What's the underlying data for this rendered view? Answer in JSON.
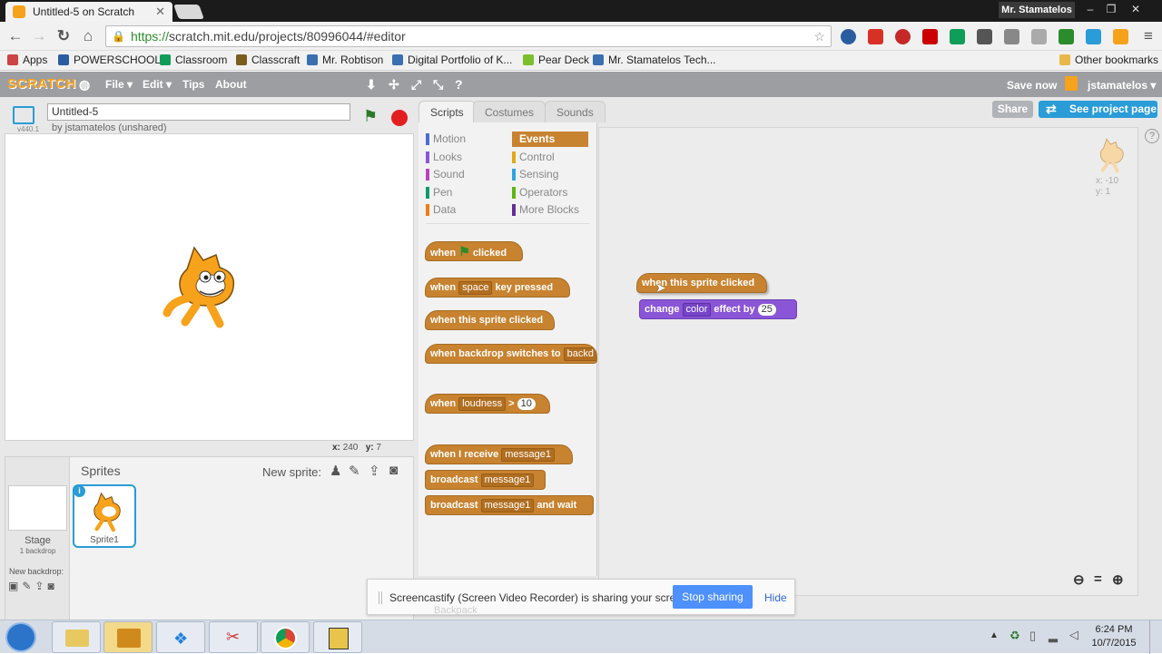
{
  "browser": {
    "tab_title": "Untitled-5 on Scratch",
    "user_chip": "Mr. Stamatelos",
    "url_https": "https://",
    "url_rest": "scratch.mit.edu/projects/80996044/#editor",
    "bookmarks": [
      {
        "label": "Apps",
        "color": "#555"
      },
      {
        "label": "POWERSCHOOL",
        "color": "#2a5d9f"
      },
      {
        "label": "Classroom",
        "color": "#0f9d58"
      },
      {
        "label": "Classcraft",
        "color": "#7a5c1e"
      },
      {
        "label": "Mr. Robtison",
        "color": "#3a6fb0"
      },
      {
        "label": "Digital Portfolio of K...",
        "color": "#3a6fb0"
      },
      {
        "label": "Pear Deck",
        "color": "#7bbf2a"
      },
      {
        "label": "Mr. Stamatelos Tech...",
        "color": "#3a6fb0"
      }
    ],
    "other_bookmarks": "Other bookmarks"
  },
  "scratch_menu": {
    "logo": "SCRATCH",
    "file": "File ▾",
    "edit": "Edit ▾",
    "tips": "Tips",
    "about": "About",
    "save_now": "Save now",
    "username": "jstamatelos ▾"
  },
  "project": {
    "title": "Untitled-5",
    "byline": "by jstamatelos (unshared)",
    "version": "v440.1",
    "coords_x_label": "x:",
    "coords_x": "240",
    "coords_y_label": "y:",
    "coords_y": "7"
  },
  "sprites_pane": {
    "heading": "Sprites",
    "new_sprite": "New sprite:",
    "stage_label": "Stage",
    "stage_sub": "1 backdrop",
    "new_backdrop": "New backdrop:",
    "sprite_name": "Sprite1"
  },
  "tabs": [
    "Scripts",
    "Costumes",
    "Sounds"
  ],
  "categories_left": [
    {
      "label": "Motion",
      "color": "#4a6cd4"
    },
    {
      "label": "Looks",
      "color": "#8a55d7"
    },
    {
      "label": "Sound",
      "color": "#bb42c3"
    },
    {
      "label": "Pen",
      "color": "#0e9a6c"
    },
    {
      "label": "Data",
      "color": "#ee7d16"
    }
  ],
  "categories_right": [
    {
      "label": "Events",
      "color": "#c88330"
    },
    {
      "label": "Control",
      "color": "#e1a91a"
    },
    {
      "label": "Sensing",
      "color": "#2ca5e2"
    },
    {
      "label": "Operators",
      "color": "#5cb712"
    },
    {
      "label": "More Blocks",
      "color": "#632d99"
    }
  ],
  "palette_blocks": {
    "flag_when": "when",
    "flag_clicked": "clicked",
    "key_when": "when",
    "key_drop": "space",
    "key_pressed": "key pressed",
    "sprite_clicked": "when this sprite clicked",
    "backdrop": "when backdrop switches to",
    "backdrop_drop": "backd",
    "loud_when": "when",
    "loud_drop": "loudness",
    "loud_gt": ">",
    "loud_val": "10",
    "receive": "when I receive",
    "receive_drop": "message1",
    "broadcast": "broadcast",
    "broadcast_drop": "message1",
    "broadcast_wait": "broadcast",
    "broadcast_wait_drop": "message1",
    "and_wait": "and wait"
  },
  "script_blocks": {
    "hat": "when this sprite clicked",
    "change": "change",
    "change_drop": "color",
    "effect_by": "effect by",
    "effect_val": "25"
  },
  "script_area": {
    "sprite_x": "x: -10",
    "sprite_y": "y: 1"
  },
  "header_buttons": {
    "share": "Share",
    "see_project": "See project page"
  },
  "share_bar": {
    "message": "Screencastify (Screen Video Recorder) is sharing your screen.",
    "stop": "Stop sharing",
    "hide": "Hide",
    "behind": "Backpack"
  },
  "taskbar": {
    "time": "6:24 PM",
    "date": "10/7/2015"
  }
}
